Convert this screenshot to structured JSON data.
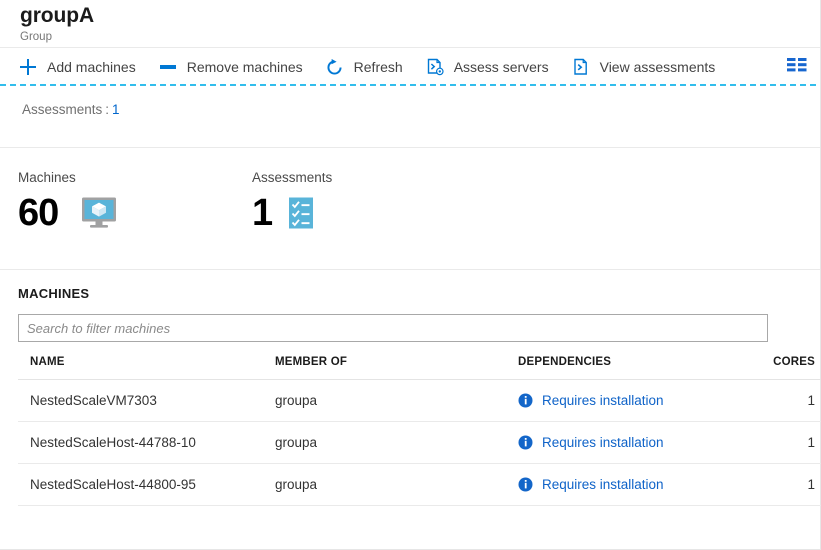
{
  "header": {
    "title": "groupA",
    "subtitle": "Group"
  },
  "toolbar": {
    "commands": [
      {
        "label": "Add machines",
        "icon": "plus-icon"
      },
      {
        "label": "Remove machines",
        "icon": "minus-icon"
      },
      {
        "label": "Refresh",
        "icon": "refresh-icon"
      },
      {
        "label": "Assess servers",
        "icon": "assess-servers-icon"
      },
      {
        "label": "View assessments",
        "icon": "view-assessments-icon"
      }
    ],
    "grid_toggle_icon": "grid-view-icon"
  },
  "properties": {
    "assessments_label": "Assessments",
    "separator": ":",
    "assessments_value": "1"
  },
  "stats": [
    {
      "label": "Machines",
      "value": "60",
      "icon": "monitor-cube-icon"
    },
    {
      "label": "Assessments",
      "value": "1",
      "icon": "checklist-icon"
    }
  ],
  "machines_section": {
    "title": "MACHINES",
    "search": {
      "placeholder": "Search to filter machines",
      "value": ""
    },
    "columns": [
      "NAME",
      "MEMBER OF",
      "DEPENDENCIES",
      "CORES"
    ],
    "rows": [
      {
        "name": "NestedScaleVM7303",
        "member_of": "groupa",
        "dependencies": "Requires installation",
        "dependencies_icon": "info-icon",
        "cores": "1"
      },
      {
        "name": "NestedScaleHost-44788-10",
        "member_of": "groupa",
        "dependencies": "Requires installation",
        "dependencies_icon": "info-icon",
        "cores": "1"
      },
      {
        "name": "NestedScaleHost-44800-95",
        "member_of": "groupa",
        "dependencies": "Requires installation",
        "dependencies_icon": "info-icon",
        "cores": "1"
      }
    ]
  },
  "colors": {
    "accent_blue": "#0078d4",
    "link_blue": "#0f63c8",
    "dashed_rule": "#32bdec",
    "icon_light_blue": "#59b4d9",
    "text_primary": "#333333",
    "text_muted": "#767676"
  }
}
